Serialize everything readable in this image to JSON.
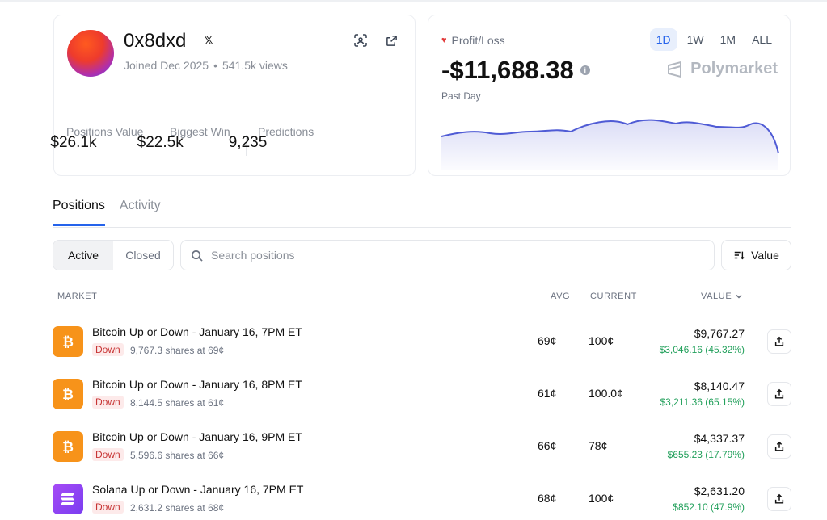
{
  "profile": {
    "username": "0x8dxd",
    "joined": "Joined Dec 2025",
    "views": "541.5k views",
    "stats": [
      {
        "label": "Positions Value",
        "value": "$26.1k"
      },
      {
        "label": "Biggest Win",
        "value": "$22.5k"
      },
      {
        "label": "Predictions",
        "value": "9,235"
      }
    ]
  },
  "pnl": {
    "title": "Profit/Loss",
    "value": "-$11,688.38",
    "period_label": "Past Day",
    "brand": "Polymarket",
    "ranges": [
      "1D",
      "1W",
      "1M",
      "ALL"
    ],
    "active_range": "1D",
    "line_color": "#4f5bd5"
  },
  "tabs": [
    "Positions",
    "Activity"
  ],
  "filters": {
    "active_label": "Active",
    "closed_label": "Closed",
    "search_placeholder": "Search positions",
    "sort_label": "Value"
  },
  "table": {
    "headers": {
      "market": "MARKET",
      "avg": "AVG",
      "current": "CURRENT",
      "value": "VALUE"
    },
    "rows": [
      {
        "title": "Bitcoin Up or Down - January 16, 7PM ET",
        "coin": "btc",
        "outcome": "Down",
        "shares": "9,767.3 shares at 69¢",
        "avg": "69¢",
        "current": "100¢",
        "value": "$9,767.27",
        "pnl": "$3,046.16 (45.32%)"
      },
      {
        "title": "Bitcoin Up or Down - January 16, 8PM ET",
        "coin": "btc",
        "outcome": "Down",
        "shares": "8,144.5 shares at 61¢",
        "avg": "61¢",
        "current": "100.0¢",
        "value": "$8,140.47",
        "pnl": "$3,211.36 (65.15%)"
      },
      {
        "title": "Bitcoin Up or Down - January 16, 9PM ET",
        "coin": "btc",
        "outcome": "Down",
        "shares": "5,596.6 shares at 66¢",
        "avg": "66¢",
        "current": "78¢",
        "value": "$4,337.37",
        "pnl": "$655.23 (17.79%)"
      },
      {
        "title": "Solana Up or Down - January 16, 7PM ET",
        "coin": "sol",
        "outcome": "Down",
        "shares": "2,631.2 shares at 68¢",
        "avg": "68¢",
        "current": "100¢",
        "value": "$2,631.20",
        "pnl": "$852.10 (47.9%)"
      }
    ]
  }
}
